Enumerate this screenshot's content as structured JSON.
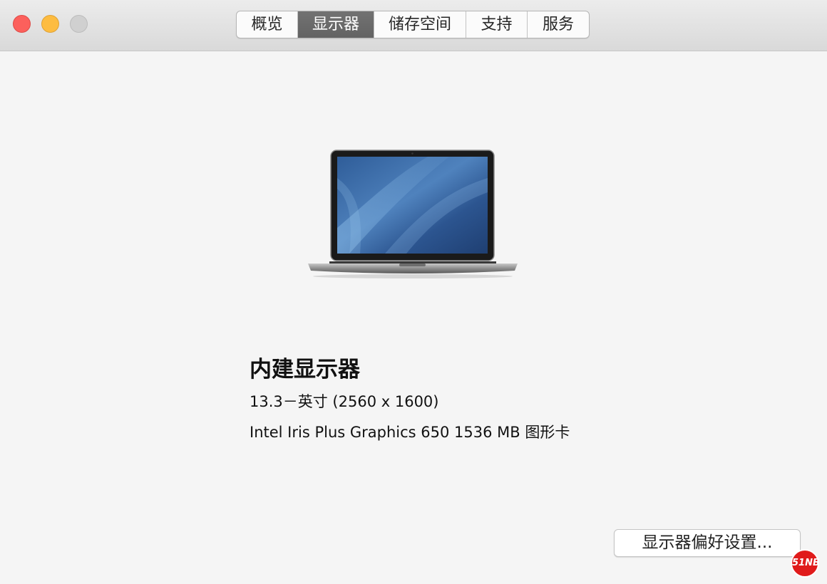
{
  "tabs": [
    {
      "label": "概览",
      "active": false
    },
    {
      "label": "显示器",
      "active": true
    },
    {
      "label": "储存空间",
      "active": false
    },
    {
      "label": "支持",
      "active": false
    },
    {
      "label": "服务",
      "active": false
    }
  ],
  "display": {
    "title": "内建显示器",
    "size_resolution": "13.3－英寸 (2560 x 1600)",
    "graphics": "Intel Iris Plus Graphics 650 1536 MB 图形卡"
  },
  "buttons": {
    "display_prefs": "显示器偏好设置..."
  },
  "watermark": {
    "label": "51NB"
  },
  "colors": {
    "close": "#fc605c",
    "minimize": "#fdbc40",
    "zoom_disabled": "#d0d0d0",
    "active_tab": "#6b6b6b"
  }
}
